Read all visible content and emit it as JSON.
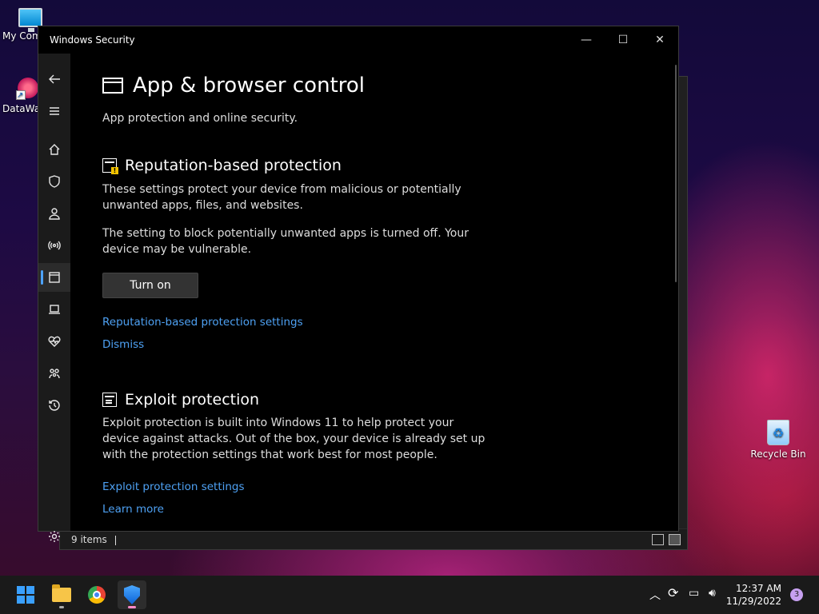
{
  "desktop": {
    "icons": [
      {
        "label": "My Com"
      },
      {
        "label": "DataWag"
      },
      {
        "label": "Recycle Bin"
      }
    ]
  },
  "explorer": {
    "status_items": "9 items"
  },
  "window": {
    "title": "Windows Security",
    "controls": {
      "minimize": "—",
      "maximize": "☐",
      "close": "✕"
    }
  },
  "page": {
    "title": "App & browser control",
    "subtitle": "App protection and online security."
  },
  "reputation": {
    "title": "Reputation-based protection",
    "desc": "These settings protect your device from malicious or potentially unwanted apps, files, and websites.",
    "warning": "The setting to block potentially unwanted apps is turned off. Your device may be vulnerable.",
    "button": "Turn on",
    "settings_link": "Reputation-based protection settings",
    "dismiss_link": "Dismiss"
  },
  "exploit": {
    "title": "Exploit protection",
    "desc": "Exploit protection is built into Windows 11 to help protect your device against attacks.  Out of the box, your device is already set up with the protection settings that work best for most people.",
    "settings_link": "Exploit protection settings",
    "learn_link": "Learn more"
  },
  "taskbar": {
    "time": "12:37 AM",
    "date": "11/29/2022",
    "notifications": "3"
  },
  "colors": {
    "accent": "#4da3ff",
    "link": "#4ea1f3",
    "warning": "#f2c200"
  }
}
